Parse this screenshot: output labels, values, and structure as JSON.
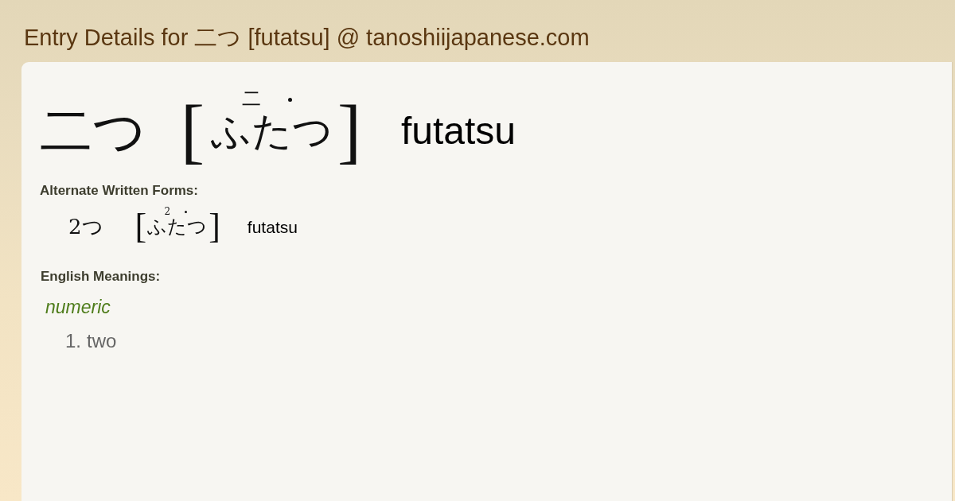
{
  "page_title": "Entry Details for 二つ [futatsu] @ tanoshiijapanese.com",
  "entry": {
    "written": "二つ",
    "bracket_open": "[",
    "reading": [
      {
        "kana": "ふた",
        "ruby": "二",
        "pitch_mark": false
      },
      {
        "kana": "つ",
        "pitch_mark": true
      }
    ],
    "bracket_close": "]",
    "romaji": "futatsu"
  },
  "alternate_forms": {
    "heading": "Alternate Written Forms:",
    "forms": [
      {
        "written": "2つ",
        "bracket_open": "[",
        "reading": [
          {
            "kana": "ふた",
            "ruby": "2",
            "pitch_mark": false
          },
          {
            "kana": "つ",
            "pitch_mark": true
          }
        ],
        "bracket_close": "]",
        "romaji": "futatsu"
      }
    ]
  },
  "meanings": {
    "heading": "English Meanings:",
    "groups": [
      {
        "part_of_speech": "numeric",
        "senses": [
          {
            "number": "1.",
            "text": "two"
          }
        ]
      }
    ]
  }
}
